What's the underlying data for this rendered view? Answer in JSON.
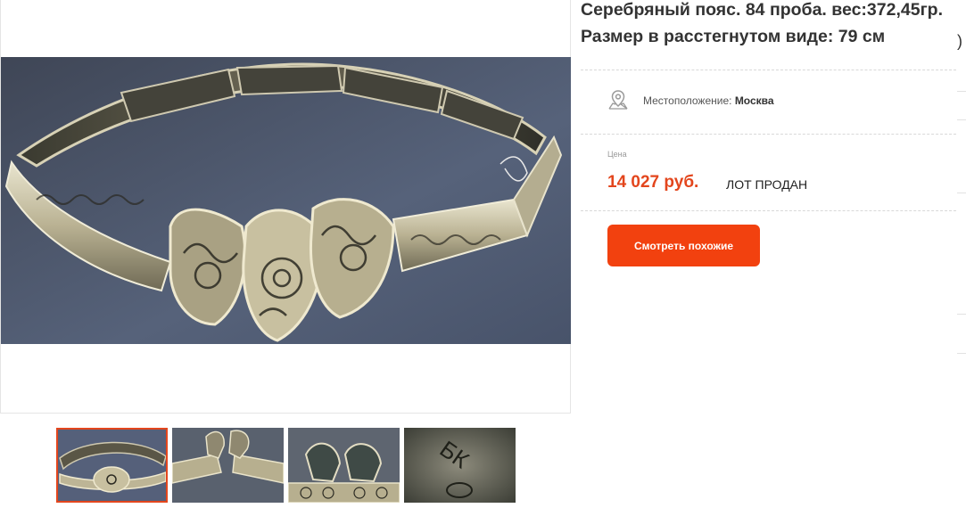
{
  "listing": {
    "title": "Серебряный пояс. 84 проба. вес:372,45гр. Размер в расстегнутом виде: 79 см",
    "location_label": "Местоположение:",
    "location_city": "Москва",
    "price_caption": "Цена",
    "price": "14 027 руб.",
    "status": "ЛОТ ПРОДАН",
    "similar_button": "Смотреть похожие"
  },
  "edge_glyph": ")",
  "thumbnails": [
    {
      "name": "thumbnail-1",
      "active": true
    },
    {
      "name": "thumbnail-2",
      "active": false
    },
    {
      "name": "thumbnail-3",
      "active": false
    },
    {
      "name": "thumbnail-4",
      "active": false
    }
  ],
  "thumbnail_4_mark": "БК",
  "colors": {
    "accent": "#f2410f",
    "price": "#e3461d",
    "photo_background": "#4b566a",
    "silver": "#cfc9b0"
  },
  "icons": {
    "location": "map-pin-icon"
  }
}
